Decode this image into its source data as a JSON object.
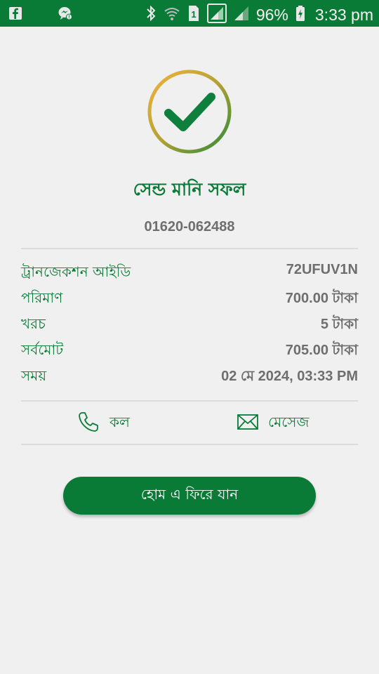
{
  "status_bar": {
    "battery": "96%",
    "time": "3:33 pm",
    "sim_slot": "1",
    "icons": [
      "facebook-icon",
      "messenger-icon",
      "bluetooth-icon",
      "wifi-icon",
      "signal-icon",
      "signal-icon",
      "battery-icon"
    ]
  },
  "success": {
    "icon": "check-circle-icon",
    "title": "সেন্ড মানি সফল",
    "recipient": "01620-062488"
  },
  "details": [
    {
      "label": "ট্রানজেকশন আইডি",
      "value": "72UFUV1N"
    },
    {
      "label": "পরিমাণ",
      "value": "700.00 টাকা"
    },
    {
      "label": "খরচ",
      "value": "5 টাকা"
    },
    {
      "label": "সর্বমোট",
      "value": "705.00 টাকা"
    },
    {
      "label": "সময়",
      "value": "02 মে 2024, 03:33 PM"
    }
  ],
  "actions": {
    "call_label": "কল",
    "message_label": "মেসেজ"
  },
  "home_button_label": "হোম এ ফিরে যান",
  "colors": {
    "brand": "#0a7a37",
    "background": "#f0f0f0",
    "value_text": "#6e6e6e",
    "ring_start": "#f0b23c",
    "ring_end": "#2f8a3a"
  }
}
